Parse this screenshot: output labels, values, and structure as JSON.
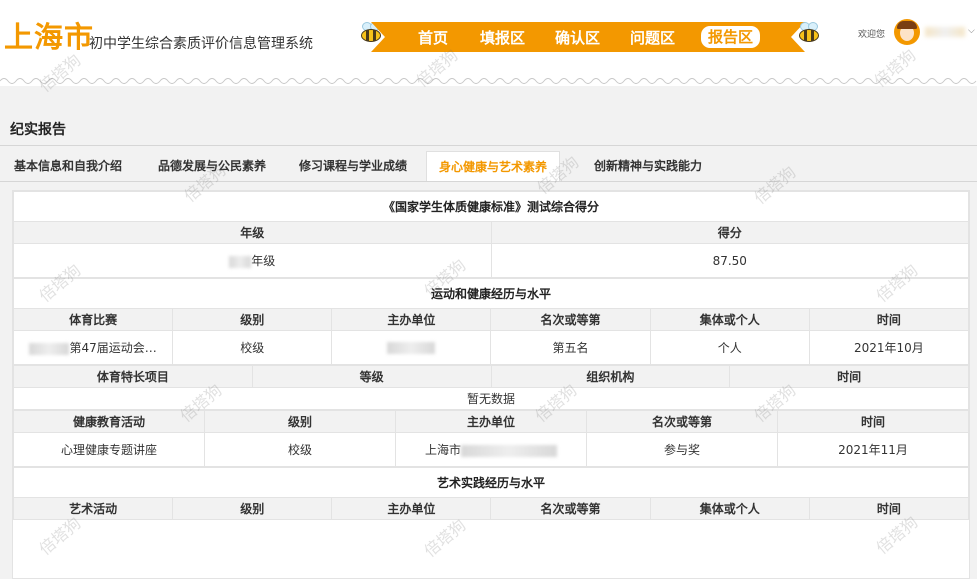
{
  "header": {
    "city": "上海市",
    "system_name": "初中学生综合素质评价信息管理系统",
    "nav": [
      "首页",
      "填报区",
      "确认区",
      "问题区",
      "报告区"
    ],
    "active_nav": "报告区",
    "welcome": "欢迎您"
  },
  "page": {
    "title": "纪实报告",
    "tabs": [
      "基本信息和自我介绍",
      "品德发展与公民素养",
      "修习课程与学业成绩",
      "身心健康与艺术素养",
      "创新精神与实践能力"
    ],
    "active_tab": "身心健康与艺术素养"
  },
  "fitness": {
    "title": "《国家学生体质健康标准》测试综合得分",
    "headers": [
      "年级",
      "得分"
    ],
    "grade": "年级",
    "score": "87.50"
  },
  "sports": {
    "title": "运动和健康经历与水平",
    "competition_headers": [
      "体育比赛",
      "级别",
      "主办单位",
      "名次或等第",
      "集体或个人",
      "时间"
    ],
    "competition_row": {
      "name": "第47届运动会…",
      "level": "校级",
      "place": "第五名",
      "type": "个人",
      "time": "2021年10月"
    },
    "specialty_headers": [
      "体育特长项目",
      "等级",
      "组织机构",
      "时间"
    ],
    "no_data": "暂无数据",
    "health_headers": [
      "健康教育活动",
      "级别",
      "主办单位",
      "名次或等第",
      "时间"
    ],
    "health_row": {
      "activity": "心理健康专题讲座",
      "level": "校级",
      "organizer": "上海市",
      "place": "参与奖",
      "time": "2021年11月"
    }
  },
  "art": {
    "title": "艺术实践经历与水平",
    "headers": [
      "艺术活动",
      "级别",
      "主办单位",
      "名次或等第",
      "集体或个人",
      "时间"
    ]
  },
  "watermark": "倍塔狗"
}
